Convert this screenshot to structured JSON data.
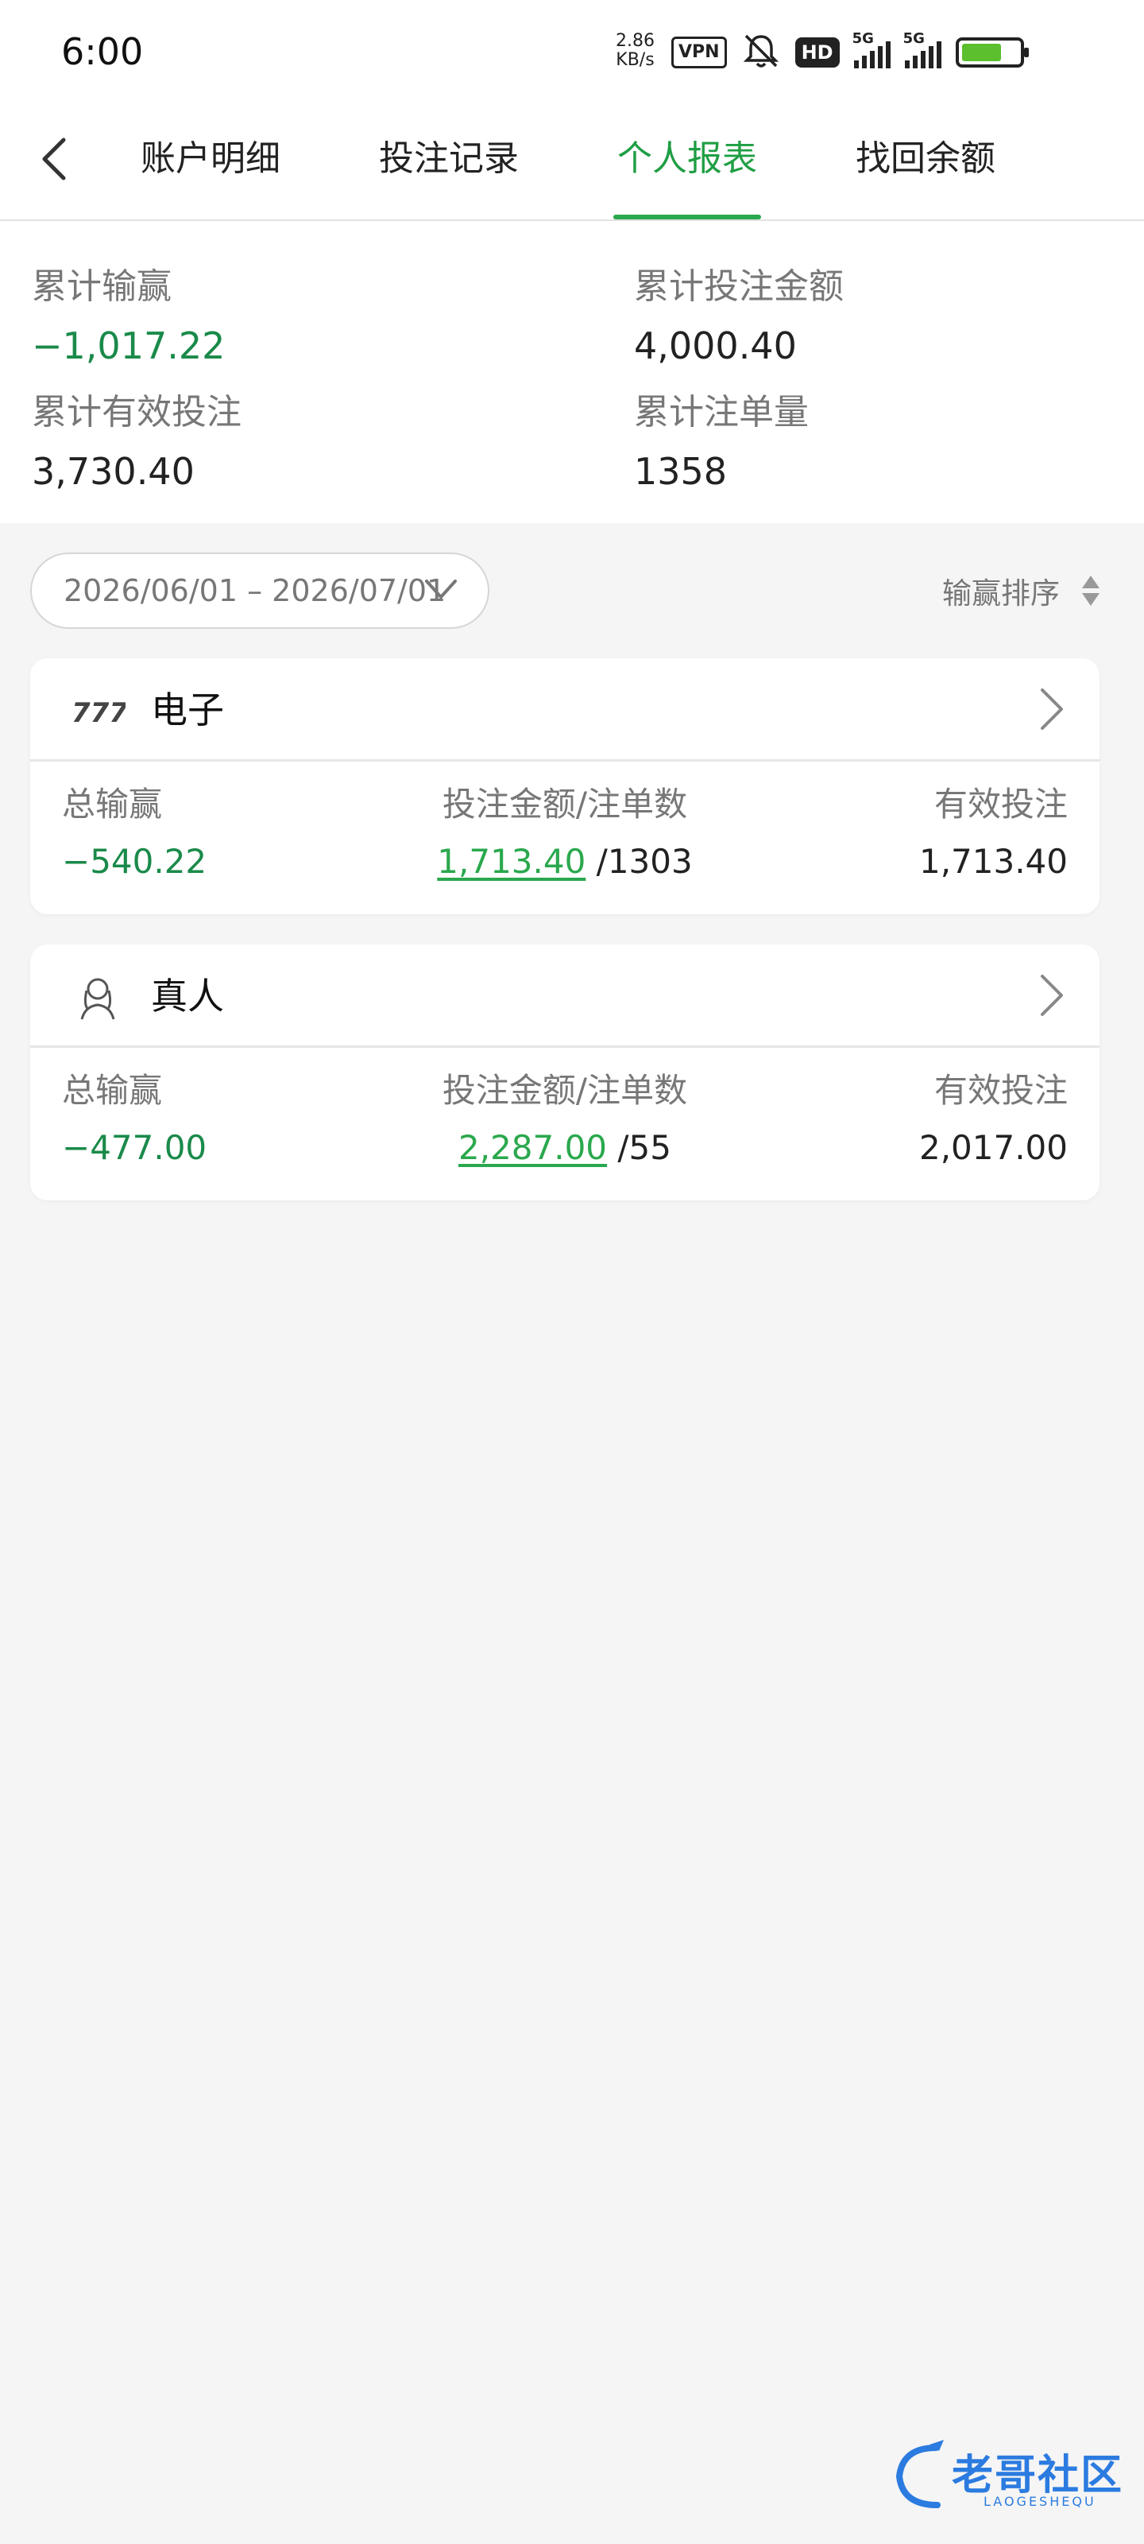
{
  "status_bar": {
    "time": "6:00",
    "net_speed_value": "2.86",
    "net_speed_unit": "KB/s",
    "vpn_label": "VPN",
    "hd_label": "HD",
    "signal_label_1": "5G",
    "signal_label_2": "5G"
  },
  "nav": {
    "tabs": [
      {
        "label": "账户明细"
      },
      {
        "label": "投注记录"
      },
      {
        "label": "个人报表"
      },
      {
        "label": "找回余额"
      }
    ],
    "active_tab_index": 2
  },
  "summary": {
    "total_win_loss": {
      "label": "累计输赢",
      "value": "−1,017.22"
    },
    "total_bet_amount": {
      "label": "累计投注金额",
      "value": "4,000.40"
    },
    "total_valid_bet": {
      "label": "累计有效投注",
      "value": "3,730.40"
    },
    "total_bet_count": {
      "label": "累计注单量",
      "value": "1358"
    }
  },
  "filter": {
    "date_range": "2026/06/01 – 2026/07/01",
    "sort_label": "输赢排序"
  },
  "cards": [
    {
      "title": "电子",
      "icon": "slot-777-icon",
      "win_loss_label": "总输赢",
      "win_loss": "−540.22",
      "bet_label": "投注金额/注单数",
      "bet_amount": "1,713.40",
      "bet_count": "/1303",
      "valid_label": "有效投注",
      "valid_bet": "1,713.40"
    },
    {
      "title": "真人",
      "icon": "live-dealer-icon",
      "win_loss_label": "总输赢",
      "win_loss": "−477.00",
      "bet_label": "投注金额/注单数",
      "bet_amount": "2,287.00",
      "bet_count": "/55",
      "valid_label": "有效投注",
      "valid_bet": "2,017.00"
    }
  ],
  "watermark": {
    "text": "老哥社区",
    "subtext": "LAOGESHEQU"
  },
  "colors": {
    "accent": "#2aa84d",
    "negative": "#1a8a4a",
    "background": "#f5f5f5"
  }
}
